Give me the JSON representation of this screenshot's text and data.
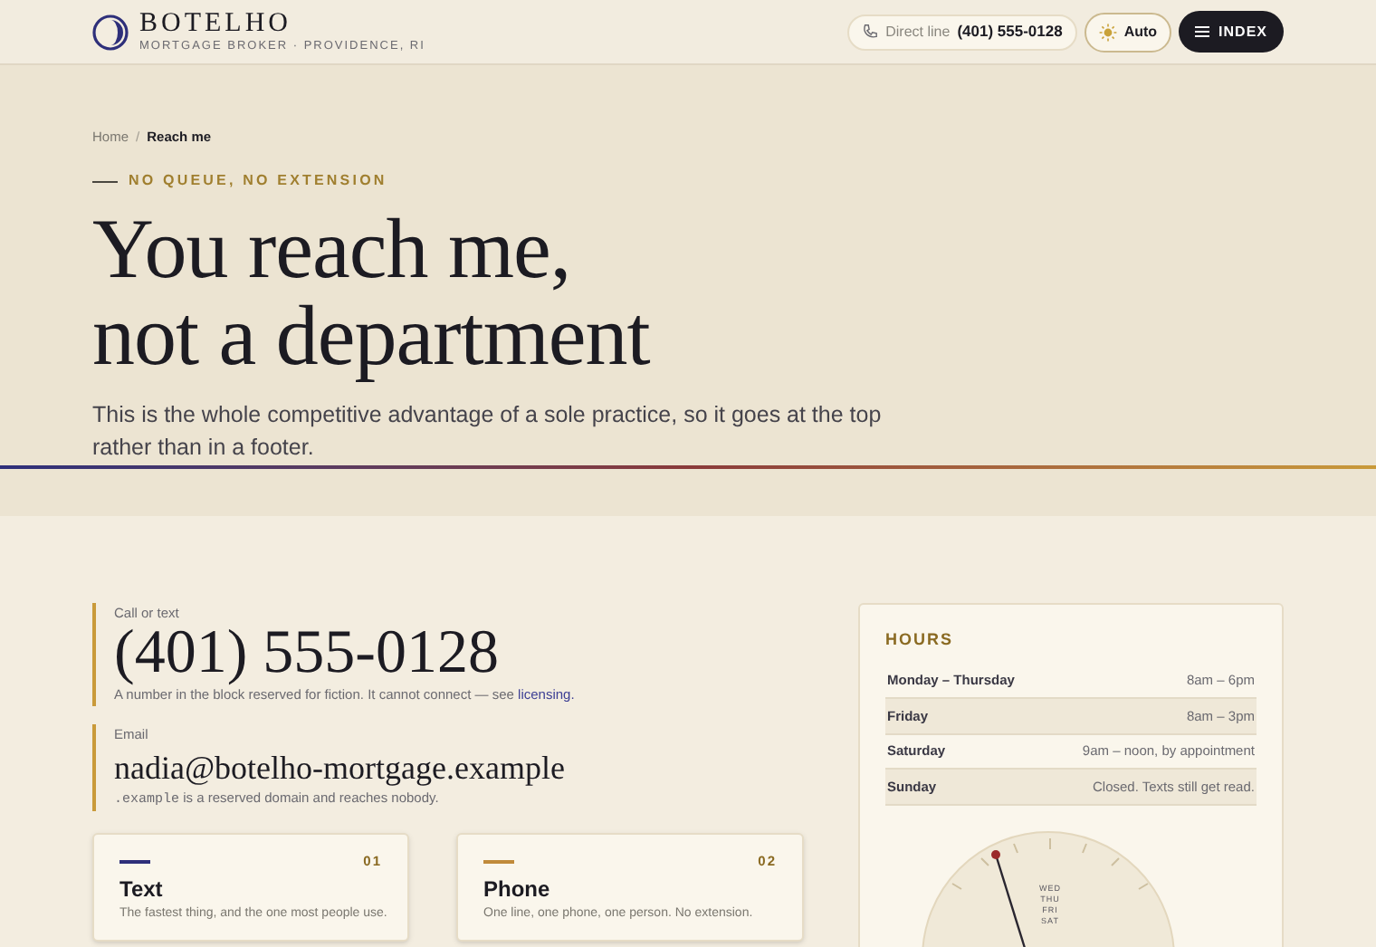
{
  "brand": {
    "name": "BOTELHO",
    "tagline": "MORTGAGE BROKER · PROVIDENCE, RI"
  },
  "header": {
    "direct_label": "Direct line",
    "direct_number": "(401) 555-0128",
    "theme": "Auto",
    "menu": "INDEX"
  },
  "breadcrumb_separator": "/",
  "breadcrumb": [
    {
      "label": "Home",
      "selected": false
    },
    {
      "label": "Reach me",
      "selected": true
    }
  ],
  "eyebrow": "NO QUEUE, NO EXTENSION",
  "title_lines": [
    "You reach me,",
    "not a department"
  ],
  "lead": "This is the whole competitive advantage of a sole practice, so it goes at the top rather than in a footer.",
  "contacts": [
    {
      "label": "Call or text",
      "value": "(401) 555-0128",
      "note": "A number in the block reserved for fiction. It cannot connect — see ",
      "link": "licensing."
    },
    {
      "label": "Email",
      "value": "nadia@botelho-mortgage.example",
      "note_code": ".example",
      "note": " is a reserved domain and reaches nobody."
    }
  ],
  "hours": {
    "title": "HOURS",
    "rows": [
      {
        "day": "Monday – Thursday",
        "time": "8am – 6pm",
        "shaded": false
      },
      {
        "day": "Friday",
        "time": "8am – 3pm",
        "shaded": true
      },
      {
        "day": "Saturday",
        "time": "9am – noon, by appointment",
        "shaded": false
      },
      {
        "day": "Sunday",
        "time": "Closed. Texts still get read.",
        "shaded": true
      }
    ],
    "dial_days": [
      "WED",
      "THU",
      "FRI",
      "SAT"
    ]
  },
  "channels": [
    {
      "number": "01",
      "title": "Text",
      "desc": "The fastest thing, and the one most people use.",
      "color": "#2e2f7a"
    },
    {
      "number": "02",
      "title": "Phone",
      "desc": "One line, one phone, one person. No extension.",
      "color": "#c08a3a"
    }
  ]
}
